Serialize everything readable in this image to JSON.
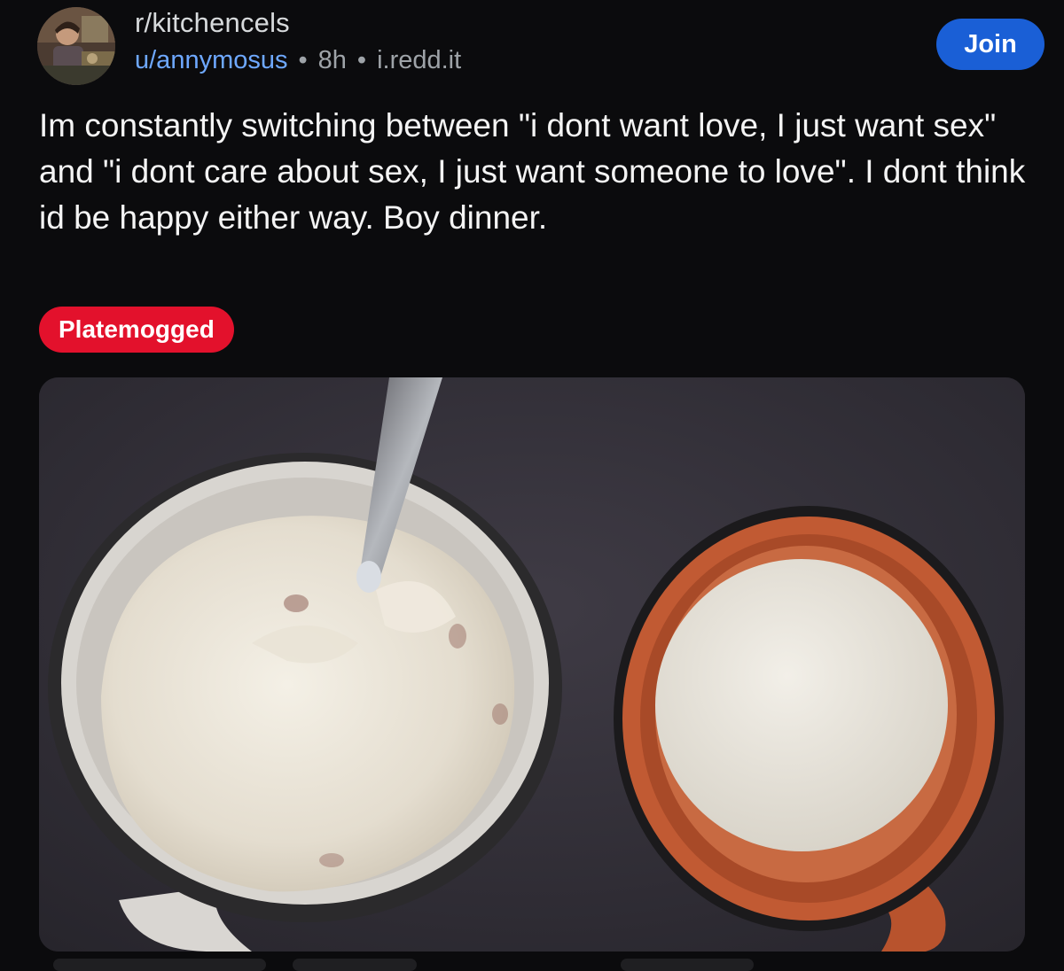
{
  "post": {
    "subreddit": "r/kitchencels",
    "author": "u/annymosus",
    "age": "8h",
    "domain": "i.redd.it",
    "separator": "•",
    "join_label": "Join",
    "title": "Im constantly switching between \"i dont want love, I just want sex\" and \"i dont care about sex, I just want someone to love\". I dont think id be happy either way. Boy dinner.",
    "flair": "Platemogged"
  },
  "colors": {
    "background": "#0b0b0d",
    "join_button": "#1a5fd6",
    "flair": "#e3112c",
    "username_link": "#6ea8ff",
    "meta_text": "#9ea3a8"
  },
  "icons": {
    "avatar": "subreddit-avatar"
  }
}
